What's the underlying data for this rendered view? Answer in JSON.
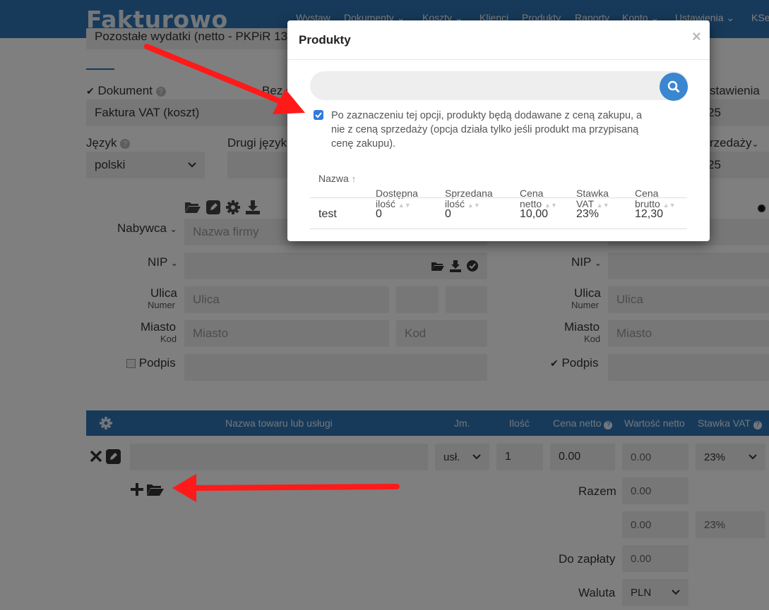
{
  "app": {
    "logo": "Fakturowo"
  },
  "nav": [
    "Wystaw",
    "Dokumenty",
    "Koszty",
    "Klienci",
    "Produkty",
    "Raporty",
    "Konto",
    "Ustawienia",
    "KSe"
  ],
  "form": {
    "top_partial": "Pozostałe wydatki (netto - PKPiR 13)",
    "document_label": "Dokument",
    "document_value": "Faktura VAT (koszt)",
    "bez_label": "Bez o",
    "settings_partial": "stawienia",
    "right_value_1": "25",
    "right_value_2": "25",
    "sprzedazy_partial": "rzedaży",
    "language_label": "Język",
    "language_value": "polski",
    "second_language_label": "Drugi język"
  },
  "buyer": {
    "label": "Nabywca",
    "name_placeholder": "Nazwa firmy",
    "nip_label": "NIP",
    "street_label": "Ulica",
    "number_label": "Numer",
    "street_placeholder": "Ulica",
    "city_label": "Miasto",
    "code_label": "Kod",
    "city_placeholder": "Miasto",
    "code_placeholder": "Kod",
    "signature_label": "Podpis"
  },
  "seller": {
    "nip_label": "NIP",
    "street_label": "Ulica",
    "number_label": "Numer",
    "street_placeholder": "Ulica",
    "city_label": "Miasto",
    "code_label": "Kod",
    "city_placeholder": "Miasto",
    "signature_label": "Podpis"
  },
  "items": {
    "headers": {
      "name": "Nazwa towaru lub usługi",
      "unit": "Jm.",
      "qty": "Ilość",
      "net_price": "Cena netto",
      "net_value": "Wartość netto",
      "vat": "Stawka VAT"
    },
    "row": {
      "unit": "usł.",
      "qty": "1",
      "net_price": "0.00",
      "net_value": "0.00",
      "vat": "23%"
    },
    "razem_label": "Razem",
    "razem_value": "0.00",
    "vat_net": "0.00",
    "vat_rate": "23%",
    "do_zaplaty_label": "Do zapłaty",
    "do_zaplaty_value": "0.00",
    "currency_label": "Waluta",
    "currency_value": "PLN"
  },
  "modal": {
    "title": "Produkty",
    "close": "×",
    "search_placeholder": "",
    "option_checked": true,
    "option_text_1": "Po zaznaczeniu tej opcji, produkty będą dodawane z ceną zakupu, a",
    "option_text_2": "nie z ceną sprzedaży (opcja działa tylko jeśli produkt ma przypisaną",
    "option_text_3": "cenę zakupu).",
    "columns": [
      [
        "Nazwa",
        ""
      ],
      [
        "Dostępna",
        "ilość"
      ],
      [
        "Sprzedana",
        "ilość"
      ],
      [
        "Cena",
        "netto"
      ],
      [
        "Stawka",
        "VAT"
      ],
      [
        "Cena",
        "brutto"
      ]
    ],
    "rows": [
      [
        "test",
        "0",
        "0",
        "10,00",
        "23%",
        "12,30"
      ]
    ]
  },
  "colors": {
    "nav": "#2e74b5",
    "arrow": "#ff1a1a",
    "search_button": "#3a86d0"
  }
}
